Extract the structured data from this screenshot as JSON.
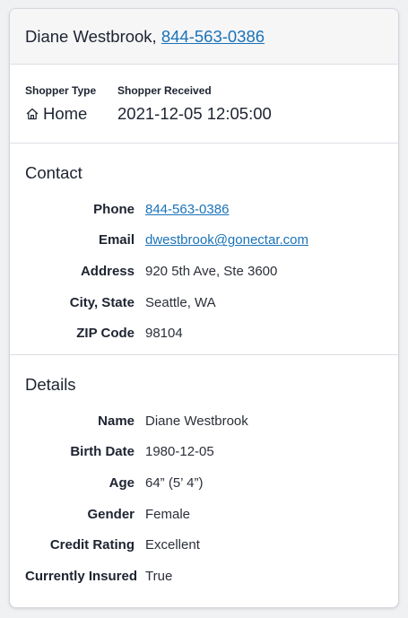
{
  "header": {
    "name": "Diane Westbrook,",
    "phone": "844-563-0386"
  },
  "shopper": {
    "type_label": "Shopper Type",
    "type_value": "Home",
    "type_icon": "home-icon",
    "received_label": "Shopper Received",
    "received_value": "2021-12-05 12:05:00"
  },
  "contact": {
    "title": "Contact",
    "rows": [
      {
        "label": "Phone",
        "value": "844-563-0386",
        "link": true
      },
      {
        "label": "Email",
        "value": "dwestbrook@gonectar.com",
        "link": true
      },
      {
        "label": "Address",
        "value": "920 5th Ave, Ste 3600",
        "link": false
      },
      {
        "label": "City, State",
        "value": "Seattle, WA",
        "link": false
      },
      {
        "label": "ZIP Code",
        "value": "98104",
        "link": false
      }
    ]
  },
  "details": {
    "title": "Details",
    "rows": [
      {
        "label": "Name",
        "value": "Diane Westbrook"
      },
      {
        "label": "Birth Date",
        "value": "1980-12-05"
      },
      {
        "label": "Age",
        "value": "64” (5’ 4”)"
      },
      {
        "label": "Gender",
        "value": "Female"
      },
      {
        "label": "Credit Rating",
        "value": "Excellent"
      },
      {
        "label": "Currently Insured",
        "value": "True"
      }
    ]
  },
  "colors": {
    "link": "#1a73b8",
    "text": "#1d2330",
    "header_bg": "#f6f6f7"
  }
}
